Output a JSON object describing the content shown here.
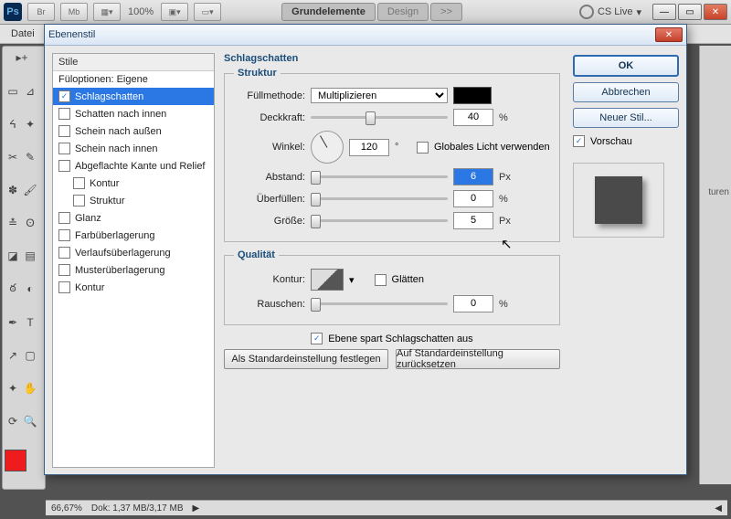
{
  "topbar": {
    "zoom": "100%"
  },
  "tabs": {
    "t1": "Grundelemente",
    "t2": "Design",
    "more": ">>",
    "cs": "CS Live"
  },
  "menu": {
    "file": "Datei"
  },
  "rightPanelHint": "turen",
  "status": {
    "zoom": "66,67%",
    "doc": "Dok: 1,37 MB/3,17 MB"
  },
  "dialog": {
    "title": "Ebenenstil",
    "ok": "OK",
    "cancel": "Abbrechen",
    "newStyle": "Neuer Stil...",
    "preview": "Vorschau",
    "list": {
      "hdr": "Stile",
      "opts": "Füloptionen: Eigene",
      "i": [
        "Schlagschatten",
        "Schatten nach innen",
        "Schein nach außen",
        "Schein nach innen",
        "Abgeflachte Kante und Relief",
        "Kontur",
        "Struktur",
        "Glanz",
        "Farbüberlagerung",
        "Verlaufsüberlagerung",
        "Musterüberlagerung",
        "Kontur"
      ]
    },
    "sectionTitle": "Schlagschatten",
    "struct": {
      "legend": "Struktur",
      "blendLabel": "Füllmethode:",
      "blendValue": "Multiplizieren",
      "opacityLabel": "Deckkraft:",
      "opacityVal": "40",
      "pct": "%",
      "angleLabel": "Winkel:",
      "angleVal": "120",
      "deg": "°",
      "globalLabel": "Globales Licht verwenden",
      "distLabel": "Abstand:",
      "distVal": "6",
      "px": "Px",
      "spreadLabel": "Überfüllen:",
      "spreadVal": "0",
      "sizeLabel": "Größe:",
      "sizeVal": "5"
    },
    "qual": {
      "legend": "Qualität",
      "contourLabel": "Kontur:",
      "antiLabel": "Glätten",
      "noiseLabel": "Rauschen:",
      "noiseVal": "0"
    },
    "knock": "Ebene spart Schlagschatten aus",
    "setDefault": "Als Standardeinstellung festlegen",
    "resetDefault": "Auf Standardeinstellung zurücksetzen"
  }
}
